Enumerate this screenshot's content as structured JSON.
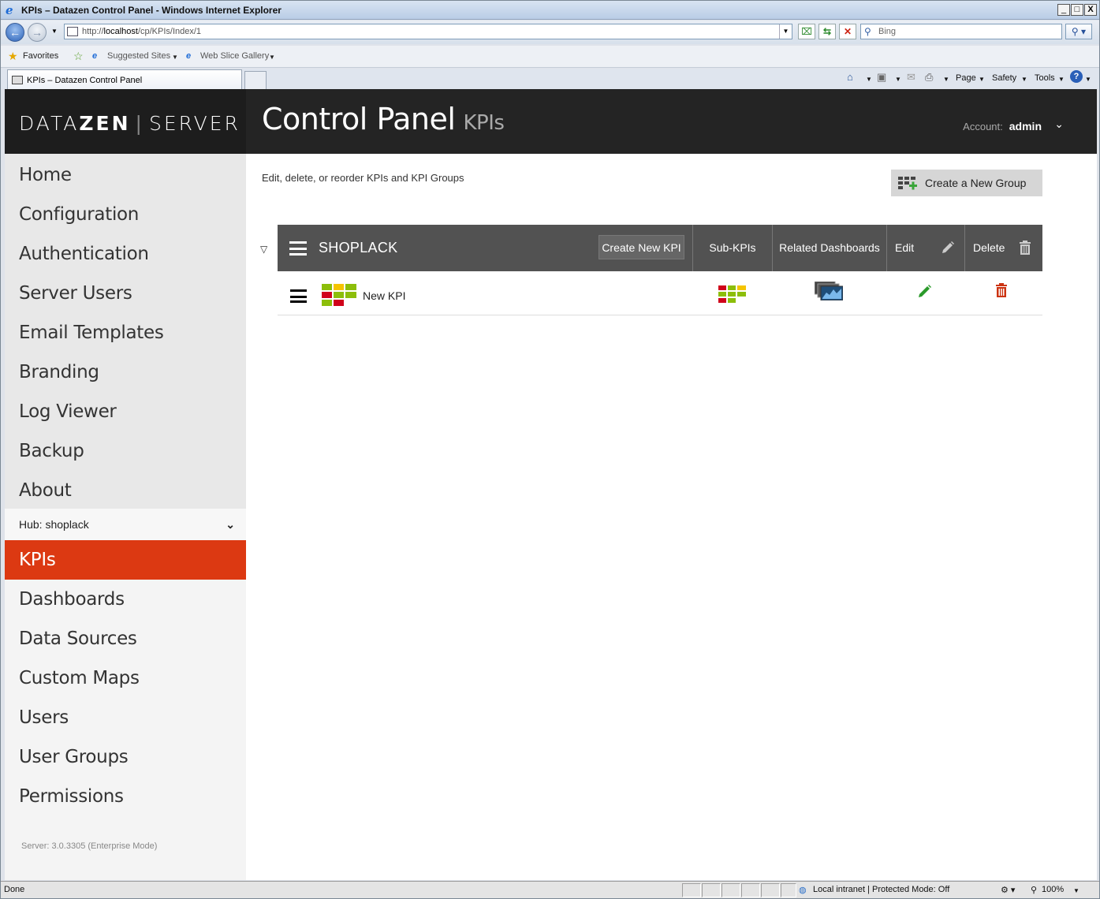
{
  "window": {
    "title": "KPIs – Datazen Control Panel - Windows Internet Explorer",
    "buttons": {
      "minimize": "_",
      "maximize": "□",
      "close": "X"
    }
  },
  "browser": {
    "url_prefix": "http://",
    "url_host": "localhost",
    "url_path": "/cp/KPIs/Index/1",
    "search_placeholder": "Bing",
    "favorites_label": "Favorites",
    "suggested_sites": "Suggested Sites",
    "web_slice_gallery": "Web Slice Gallery",
    "tab_title": "KPIs – Datazen Control Panel",
    "commands": {
      "page": "Page",
      "safety": "Safety",
      "tools": "Tools"
    }
  },
  "app": {
    "logo_left": "DATA",
    "logo_bold": "ZEN",
    "logo_right": "SERVER",
    "title": "Control Panel",
    "subtitle": "KPIs",
    "account_label": "Account:",
    "account_name": "admin"
  },
  "sidebar": {
    "system_items": [
      "Home",
      "Configuration",
      "Authentication",
      "Server Users",
      "Email Templates",
      "Branding",
      "Log Viewer",
      "Backup",
      "About"
    ],
    "hub_label": "Hub: shoplack",
    "hub_items": [
      "KPIs",
      "Dashboards",
      "Data Sources",
      "Custom Maps",
      "Users",
      "User Groups",
      "Permissions"
    ],
    "active_item": "KPIs",
    "version": "Server: 3.0.3305 (Enterprise Mode)"
  },
  "main": {
    "description": "Edit, delete, or reorder KPIs and KPI Groups",
    "create_group_label": "Create a New Group",
    "group": {
      "name": "SHOPLACK",
      "create_kpi_label": "Create New KPI",
      "columns": {
        "sub_kpis": "Sub-KPIs",
        "related_dashboards": "Related Dashboards",
        "edit": "Edit",
        "delete": "Delete"
      }
    },
    "kpis": [
      {
        "name": "New KPI"
      }
    ]
  },
  "statusbar": {
    "text": "Done",
    "zone": "Local intranet | Protected Mode: Off",
    "zoom": "100%"
  },
  "colors": {
    "accent": "#dc3912",
    "header": "#242424",
    "group_bar": "#525252",
    "kpi_red": "#d0021b",
    "kpi_green": "#8cbe0a",
    "kpi_yellow": "#f5c400",
    "edit_green": "#2a9a2a",
    "delete_red": "#cc3311"
  },
  "icons": [
    "ie-icon",
    "back-icon",
    "forward-icon",
    "refresh-icon",
    "stop-icon",
    "search-icon",
    "star-icon",
    "home-icon",
    "rss-icon",
    "mail-icon",
    "print-icon",
    "help-icon",
    "hamburger-icon",
    "pencil-icon",
    "trash-icon",
    "kpi-grid-icon",
    "dashboards-icon",
    "add-group-icon"
  ]
}
